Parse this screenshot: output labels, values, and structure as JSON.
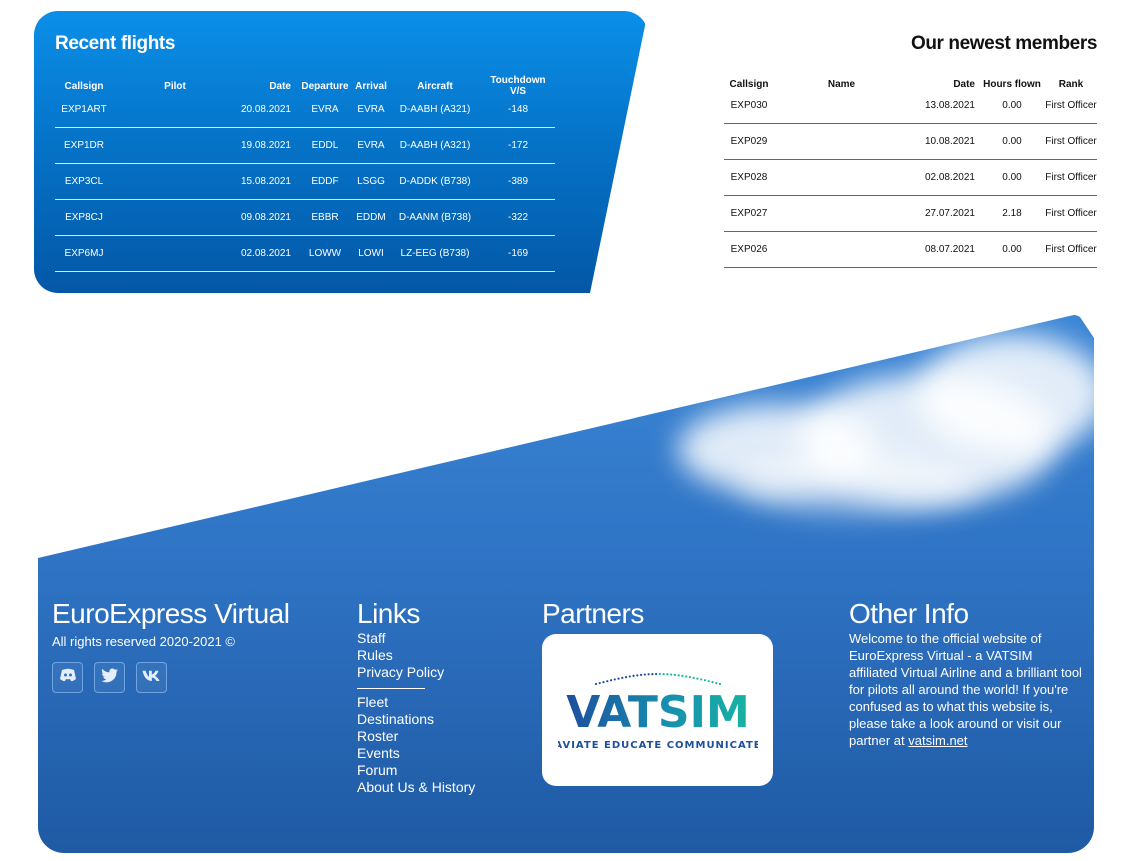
{
  "recent_flights": {
    "title": "Recent flights",
    "columns": [
      "Callsign",
      "Pilot",
      "Date",
      "Departure",
      "Arrival",
      "Aircraft",
      "Touchdown V/S"
    ],
    "rows": [
      {
        "callsign": "EXP1ART",
        "pilot": "",
        "date": "20.08.2021",
        "departure": "EVRA",
        "arrival": "EVRA",
        "aircraft": "D-AABH (A321)",
        "vs": "-148"
      },
      {
        "callsign": "EXP1DR",
        "pilot": "",
        "date": "19.08.2021",
        "departure": "EDDL",
        "arrival": "EVRA",
        "aircraft": "D-AABH (A321)",
        "vs": "-172"
      },
      {
        "callsign": "EXP3CL",
        "pilot": "",
        "date": "15.08.2021",
        "departure": "EDDF",
        "arrival": "LSGG",
        "aircraft": "D-ADDK (B738)",
        "vs": "-389"
      },
      {
        "callsign": "EXP8CJ",
        "pilot": "",
        "date": "09.08.2021",
        "departure": "EBBR",
        "arrival": "EDDM",
        "aircraft": "D-AANM (B738)",
        "vs": "-322"
      },
      {
        "callsign": "EXP6MJ",
        "pilot": "",
        "date": "02.08.2021",
        "departure": "LOWW",
        "arrival": "LOWI",
        "aircraft": "LZ-EEG (B738)",
        "vs": "-169"
      }
    ]
  },
  "newest_members": {
    "title": "Our newest members",
    "columns": [
      "Callsign",
      "Name",
      "Date",
      "Hours flown",
      "Rank"
    ],
    "rows": [
      {
        "callsign": "EXP030",
        "name": "",
        "date": "13.08.2021",
        "hours": "0.00",
        "rank": "First Officer"
      },
      {
        "callsign": "EXP029",
        "name": "",
        "date": "10.08.2021",
        "hours": "0.00",
        "rank": "First Officer"
      },
      {
        "callsign": "EXP028",
        "name": "",
        "date": "02.08.2021",
        "hours": "0.00",
        "rank": "First Officer"
      },
      {
        "callsign": "EXP027",
        "name": "",
        "date": "27.07.2021",
        "hours": "2.18",
        "rank": "First Officer"
      },
      {
        "callsign": "EXP026",
        "name": "",
        "date": "08.07.2021",
        "hours": "0.00",
        "rank": "First Officer"
      }
    ]
  },
  "footer": {
    "brand": {
      "name": "EuroExpress Virtual",
      "rights": "All rights reserved 2020-2021 ©",
      "socials": [
        {
          "icon": "discord-icon"
        },
        {
          "icon": "twitter-icon"
        },
        {
          "icon": "vk-icon"
        }
      ]
    },
    "links": {
      "title": "Links",
      "group1": [
        "Staff",
        "Rules",
        "Privacy Policy"
      ],
      "group2": [
        "Fleet",
        "Destinations",
        "Roster",
        "Events",
        "Forum",
        "About Us & History"
      ]
    },
    "partners": {
      "title": "Partners",
      "logo_text": "VATSIM",
      "logo_tagline": "AVIATE EDUCATE COMMUNICATE"
    },
    "info": {
      "title": "Other Info",
      "text": "Welcome to the official website of EuroExpress Virtual - a VATSIM affiliated Virtual Airline and a brilliant tool for pilots all around the world! If you're confused as to what this website is, please take a look around or visit our partner at",
      "link_text": "vatsim.net"
    }
  },
  "colors": {
    "panel_blue": "#0574c9",
    "footer_blue": "#2f74c5",
    "vatsim_blue": "#1d4f9e",
    "vatsim_teal": "#17b3a3"
  }
}
